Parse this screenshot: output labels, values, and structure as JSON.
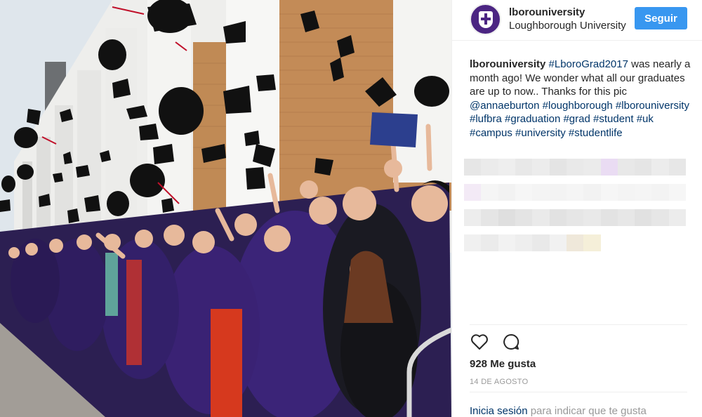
{
  "header": {
    "username": "lborouniversity",
    "location": "Loughborough University",
    "follow_label": "Seguir"
  },
  "caption": {
    "author": "lborouniversity",
    "hashtag_grad": "#LboroGrad2017",
    "text1": " was nearly a month ago! We wonder what all our graduates are up to now.. Thanks for this pic ",
    "mention": "@annaeburton",
    "tags": [
      "#loughborough",
      "#lborouniversity",
      "#lufbra",
      "#graduation",
      "#grad",
      "#student",
      "#uk",
      "#campus",
      "#university",
      "#studentlife"
    ]
  },
  "actions": {
    "like_icon": "heart-icon",
    "comment_icon": "speech-bubble-icon"
  },
  "likes_text": "928 Me gusta",
  "date_text": "14 DE AGOSTO",
  "login": {
    "link": "Inicia sesión",
    "rest": " para indicar que te gusta"
  },
  "photo": {
    "description_icon": "graduation-photo"
  },
  "colors": {
    "follow": "#3897f0",
    "link": "#003569",
    "gown_purple": "#3b2478",
    "avatar": "#4b2582"
  }
}
